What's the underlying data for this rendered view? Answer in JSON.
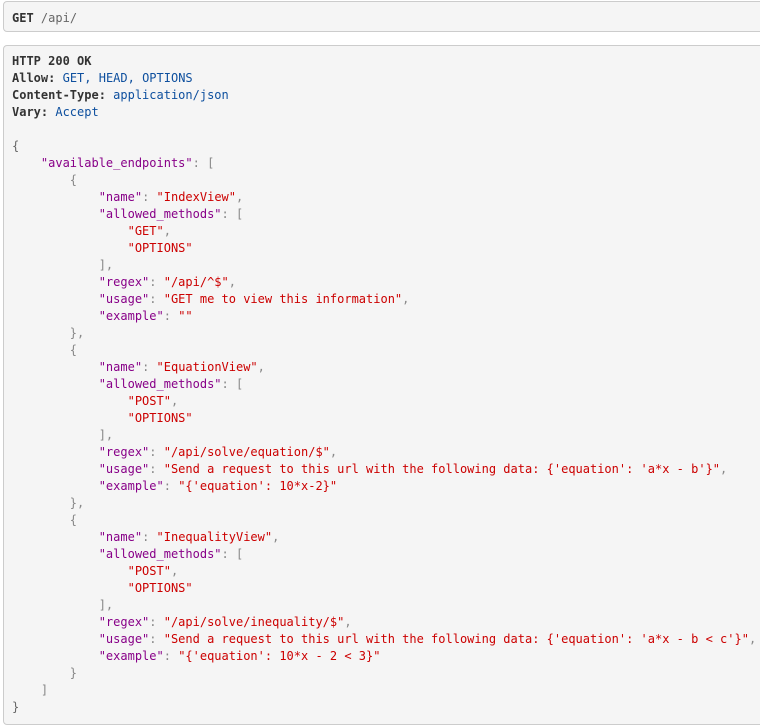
{
  "request": {
    "method": "GET",
    "path": "/api/"
  },
  "response": {
    "status": "HTTP 200 OK",
    "headers": [
      {
        "key": "Allow:",
        "value": "GET, HEAD, OPTIONS"
      },
      {
        "key": "Content-Type:",
        "value": "application/json"
      },
      {
        "key": "Vary:",
        "value": "Accept"
      }
    ],
    "body": {
      "root_key": "\"available_endpoints\"",
      "endpoints": [
        {
          "name": "\"IndexView\"",
          "allowed_methods": [
            "\"GET\"",
            "\"OPTIONS\""
          ],
          "regex": "\"/api/^$\"",
          "usage": "\"GET me to view this information\"",
          "example": "\"\""
        },
        {
          "name": "\"EquationView\"",
          "allowed_methods": [
            "\"POST\"",
            "\"OPTIONS\""
          ],
          "regex": "\"/api/solve/equation/$\"",
          "usage": "\"Send a request to this url with the following data: {'equation': 'a*x - b'}\"",
          "example": "\"{'equation': 10*x-2}\""
        },
        {
          "name": "\"InequalityView\"",
          "allowed_methods": [
            "\"POST\"",
            "\"OPTIONS\""
          ],
          "regex": "\"/api/solve/inequality/$\"",
          "usage": "\"Send a request to this url with the following data: {'equation': 'a*x - b < c'}\"",
          "example": "\"{'equation': 10*x - 2 < 3}\""
        }
      ],
      "key_labels": {
        "name": "\"name\"",
        "allowed_methods": "\"allowed_methods\"",
        "regex": "\"regex\"",
        "usage": "\"usage\"",
        "example": "\"example\""
      }
    }
  }
}
